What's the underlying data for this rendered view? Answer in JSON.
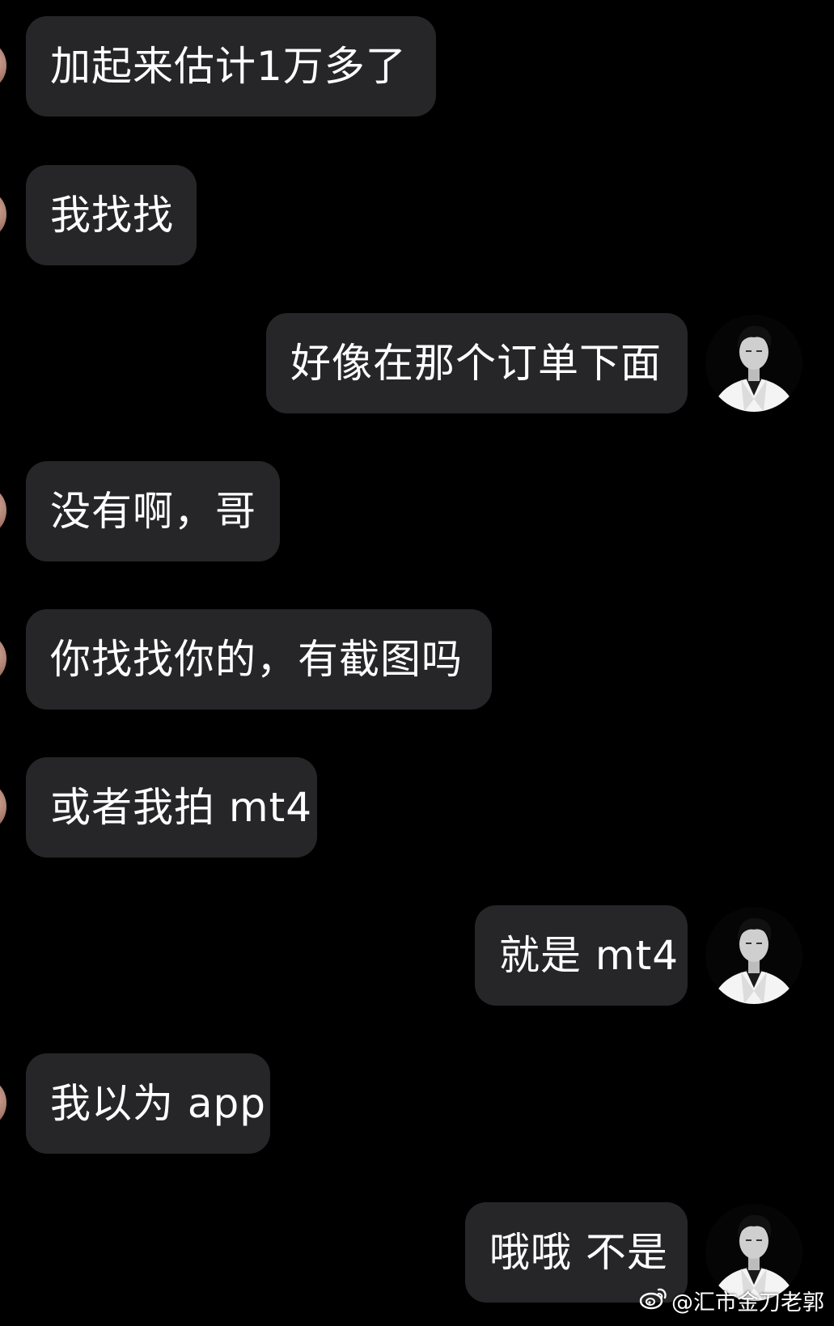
{
  "messages": [
    {
      "side": "in",
      "text": "加起来估计1万多了"
    },
    {
      "side": "in",
      "text": "我找找"
    },
    {
      "side": "out",
      "text": "好像在那个订单下面"
    },
    {
      "side": "in",
      "text": "没有啊，哥"
    },
    {
      "side": "in",
      "text": "你找找你的，有截图吗"
    },
    {
      "side": "in",
      "text": "或者我拍 mt4"
    },
    {
      "side": "out",
      "text": "就是 mt4"
    },
    {
      "side": "in",
      "text": "我以为 app"
    },
    {
      "side": "out",
      "text": "哦哦 不是"
    }
  ],
  "watermark": {
    "text": "@汇市金刀老郭",
    "icon": "weibo-icon"
  },
  "colors": {
    "background": "#000000",
    "bubble": "#262628",
    "text": "#ffffff"
  }
}
